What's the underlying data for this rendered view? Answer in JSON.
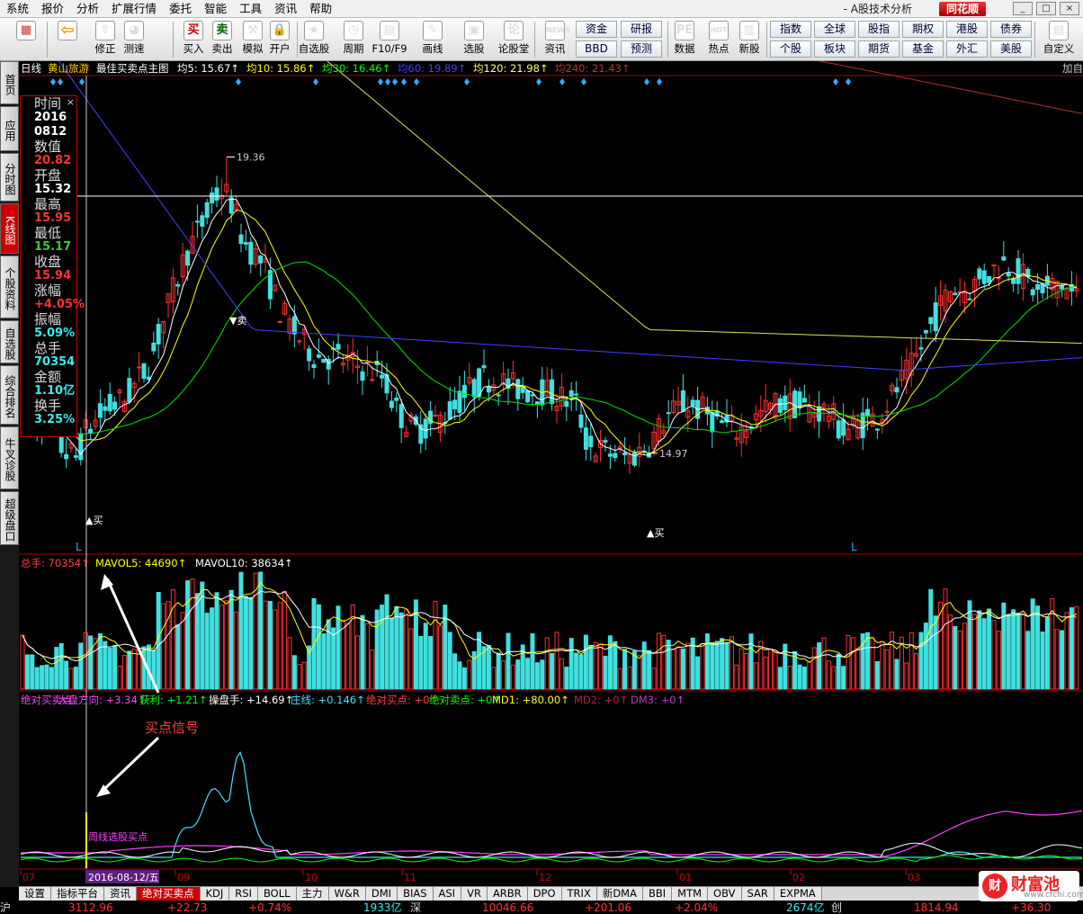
{
  "menu": [
    "系统",
    "报价",
    "分析",
    "扩展行情",
    "委托",
    "智能",
    "工具",
    "资讯",
    "帮助"
  ],
  "brand": "同花顺",
  "subtitle": "- A股技术分析",
  "window_controls": [
    "_",
    "□",
    "×"
  ],
  "toolbar": {
    "buttons": [
      {
        "label": "",
        "glyph": "▦",
        "name": "layout"
      },
      {
        "label": "",
        "glyph": "⇦",
        "name": "back"
      },
      {
        "label": "修正",
        "glyph": "⇧",
        "name": "revise"
      },
      {
        "label": "测速",
        "glyph": "◕",
        "name": "speed"
      },
      {
        "label": "买入",
        "glyph": "买",
        "name": "buy"
      },
      {
        "label": "卖出",
        "glyph": "卖",
        "name": "sell"
      },
      {
        "label": "模拟",
        "glyph": "⚒",
        "name": "simulate"
      },
      {
        "label": "开户",
        "glyph": "🔒",
        "name": "open-account"
      },
      {
        "label": "自选股",
        "glyph": "★",
        "name": "watchlist"
      },
      {
        "label": "周期",
        "glyph": "◷",
        "name": "period"
      },
      {
        "label": "F10/F9",
        "glyph": "▤",
        "name": "f10"
      },
      {
        "label": "画线",
        "glyph": "✎",
        "name": "draw-line"
      },
      {
        "label": "选股",
        "glyph": "▣",
        "name": "stock-picker"
      },
      {
        "label": "论股堂",
        "glyph": "论",
        "name": "forum"
      },
      {
        "label": "资讯",
        "glyph": "NEWS",
        "name": "news"
      },
      {
        "label": "数据",
        "glyph": "PE",
        "name": "data"
      },
      {
        "label": "热点",
        "glyph": "HOT",
        "name": "hot"
      },
      {
        "label": "新股",
        "glyph": "▥",
        "name": "ipo"
      },
      {
        "label": "自定义",
        "glyph": "▤",
        "name": "customize"
      }
    ],
    "small1": [
      "资金",
      "研报",
      "BBD",
      "预测"
    ],
    "small2": [
      "指数",
      "全球",
      "股指",
      "期权",
      "港股",
      "债券",
      "个股",
      "板块",
      "期货",
      "基金",
      "外汇",
      "美股"
    ]
  },
  "left_tabs": [
    "首页",
    "应用",
    "分时图",
    "K线图",
    "个股资料",
    "自选股",
    "综合排名",
    "牛叉诊股",
    "超级盘口"
  ],
  "main_legend": {
    "period": "日线",
    "stock": "黄山旅游",
    "indicator": "最佳买卖点主图",
    "ma": [
      {
        "label": "均5: 15.67",
        "color": "#ffffff"
      },
      {
        "label": "均10: 15.86",
        "color": "#ffff00"
      },
      {
        "label": "均30: 16.46",
        "color": "#00ff00"
      },
      {
        "label": "均60: 19.89",
        "color": "#4040ff"
      },
      {
        "label": "均120: 21.98",
        "color": "#ffff60"
      },
      {
        "label": "均240: 21.43",
        "color": "#c03030"
      }
    ],
    "add": "加自"
  },
  "info": {
    "close_icon": "×",
    "rows": [
      {
        "k": "时间",
        "v": "2016",
        "v2": "0812",
        "c": "wht"
      },
      {
        "k": "数值",
        "v": "20.82",
        "c": "red"
      },
      {
        "k": "开盘",
        "v": "15.32",
        "c": "wht"
      },
      {
        "k": "最高",
        "v": "15.95",
        "c": "red"
      },
      {
        "k": "最低",
        "v": "15.17",
        "c": "grn"
      },
      {
        "k": "收盘",
        "v": "15.94",
        "c": "red"
      },
      {
        "k": "涨幅",
        "v": "+4.05%",
        "c": "red"
      },
      {
        "k": "振幅",
        "v": "5.09%",
        "c": "cy"
      },
      {
        "k": "总手",
        "v": "70354",
        "c": "cy"
      },
      {
        "k": "金额",
        "v": "1.10亿",
        "c": "cy"
      },
      {
        "k": "换手",
        "v": "3.25%",
        "c": "cy"
      }
    ]
  },
  "annotations": {
    "high": "19.36",
    "low": "14.97",
    "sell": "卖",
    "buy": "买",
    "L": "L",
    "signal": "买点信号",
    "weekly": "周线选股买点"
  },
  "vol_legend": [
    {
      "label": "总手: 70354",
      "color": "#ff4040"
    },
    {
      "label": "MAVOL5: 44690",
      "color": "#ffff00"
    },
    {
      "label": "MAVOL10: 38634",
      "color": "#ffffff"
    }
  ],
  "ind_legend": [
    {
      "label": "绝对买卖点",
      "color": "#ff40ff"
    },
    {
      "label": "大盘方向: +3.34",
      "color": "#ff40ff"
    },
    {
      "label": "获利: +1.21",
      "color": "#00ff00"
    },
    {
      "label": "操盘手: +14.69",
      "color": "#ffffff"
    },
    {
      "label": "庄线: +0.146",
      "color": "#40e0ff"
    },
    {
      "label": "绝对买点: +0",
      "color": "#ff4040"
    },
    {
      "label": "绝对卖点: +0",
      "color": "#00ff00"
    },
    {
      "label": "MD1: +80.00",
      "color": "#ffff00"
    },
    {
      "label": "MD2: +0",
      "color": "#b02040"
    },
    {
      "label": "DM3: +0",
      "color": "#b040c0"
    }
  ],
  "x_axis": {
    "months": [
      "07",
      "09",
      "10",
      "11",
      "12",
      "01",
      "02",
      "03"
    ],
    "cursor_date": "2016-08-12/五"
  },
  "tabs": [
    "设置",
    "指标平台",
    "资讯",
    "绝对买卖点",
    "KDJ",
    "RSI",
    "BOLL",
    "主力",
    "W&R",
    "DMI",
    "BIAS",
    "ASI",
    "VR",
    "ARBR",
    "DPO",
    "TRIX",
    "新DMA",
    "BBI",
    "MTM",
    "OBV",
    "SAR",
    "EXPMA"
  ],
  "status": [
    {
      "t": "沪",
      "c": "#ddd"
    },
    {
      "t": "3112.96",
      "c": "#f33"
    },
    {
      "t": "+22.73",
      "c": "#f33"
    },
    {
      "t": "+0.74%",
      "c": "#f33"
    },
    {
      "t": "1933亿",
      "c": "#3ee"
    },
    {
      "t": "深",
      "c": "#ddd"
    },
    {
      "t": "10046.66",
      "c": "#f33"
    },
    {
      "t": "+201.06",
      "c": "#f33"
    },
    {
      "t": "+2.04%",
      "c": "#f33"
    },
    {
      "t": "2674亿",
      "c": "#3ee"
    },
    {
      "t": "创",
      "c": "#ddd"
    },
    {
      "t": "1814.94",
      "c": "#f33"
    },
    {
      "t": "+36.30",
      "c": "#f33"
    }
  ],
  "watermark": {
    "logo": "财",
    "name": "财富池",
    "url": "www.cfchi.com"
  },
  "colors": {
    "up": "#ff3030",
    "down": "#40e0e0"
  }
}
